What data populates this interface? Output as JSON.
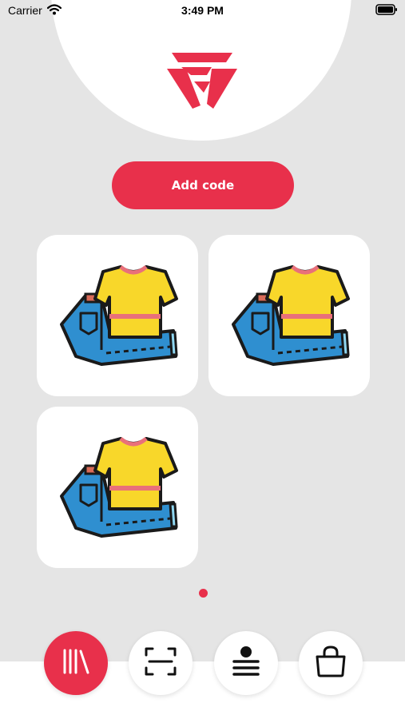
{
  "status_bar": {
    "carrier": "Carrier",
    "time": "3:49 PM"
  },
  "header": {
    "logo": "brand-logo"
  },
  "actions": {
    "add_code_label": "Add code"
  },
  "products": [
    {
      "icon": "clothes-icon"
    },
    {
      "icon": "clothes-icon"
    },
    {
      "icon": "clothes-icon"
    }
  ],
  "pager": {
    "current": 1,
    "total": 1
  },
  "bottom_nav": {
    "items": [
      {
        "icon": "library-icon",
        "active": true
      },
      {
        "icon": "scan-icon",
        "active": false
      },
      {
        "icon": "profile-list-icon",
        "active": false
      },
      {
        "icon": "shopping-bag-icon",
        "active": false
      }
    ]
  },
  "colors": {
    "accent": "#e8304b",
    "background": "#e5e5e5",
    "card": "#ffffff"
  }
}
